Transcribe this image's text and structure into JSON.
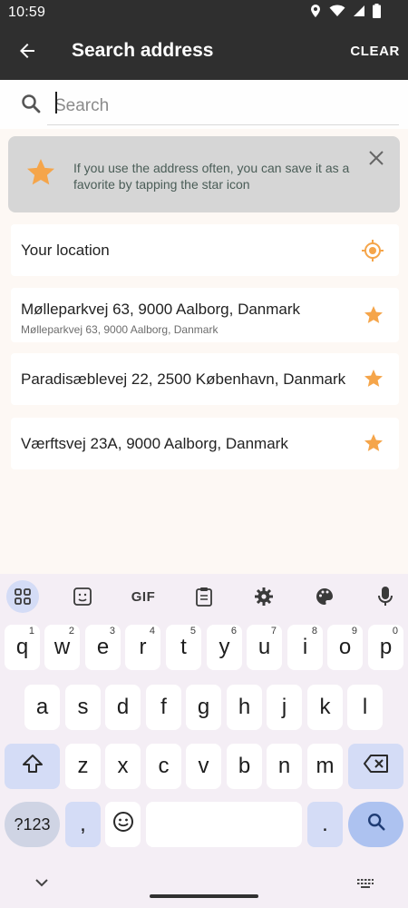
{
  "status": {
    "time": "10:59"
  },
  "appbar": {
    "title": "Search address",
    "clear_label": "CLEAR"
  },
  "search": {
    "placeholder": "Search",
    "value": ""
  },
  "tip": {
    "text": "If you use the address often, you can save it as a favorite by tapping the star icon"
  },
  "locations": [
    {
      "title": "Your location",
      "subtitle": "",
      "icon": "my-location-icon"
    },
    {
      "title": "Mølleparkvej 63, 9000 Aalborg, Danmark",
      "subtitle": "Mølleparkvej 63, 9000 Aalborg, Danmark",
      "icon": "star-icon"
    },
    {
      "title": "Paradisæblevej 22, 2500 København, Danmark",
      "subtitle": "",
      "icon": "star-icon"
    },
    {
      "title": "Værftsvej 23A, 9000 Aalborg, Danmark",
      "subtitle": "",
      "icon": "star-icon"
    }
  ],
  "keyboard": {
    "toolbar": [
      "apps-grid-icon",
      "sticker-icon",
      "GIF",
      "clipboard-icon",
      "settings-icon",
      "palette-icon",
      "mic-icon"
    ],
    "row1": [
      {
        "k": "q",
        "h": "1"
      },
      {
        "k": "w",
        "h": "2"
      },
      {
        "k": "e",
        "h": "3"
      },
      {
        "k": "r",
        "h": "4"
      },
      {
        "k": "t",
        "h": "5"
      },
      {
        "k": "y",
        "h": "6"
      },
      {
        "k": "u",
        "h": "7"
      },
      {
        "k": "i",
        "h": "8"
      },
      {
        "k": "o",
        "h": "9"
      },
      {
        "k": "p",
        "h": "0"
      }
    ],
    "row2": [
      "a",
      "s",
      "d",
      "f",
      "g",
      "h",
      "j",
      "k",
      "l"
    ],
    "row3": [
      "z",
      "x",
      "c",
      "v",
      "b",
      "n",
      "m"
    ],
    "symbols_label": "?123",
    "comma": ",",
    "period": "."
  },
  "colors": {
    "accent": "#f5a54a",
    "appbar": "#2f2f2f",
    "tip_bg": "#d6d6d6",
    "key_func": "#d4dcf6",
    "key_search": "#adc2f0"
  }
}
